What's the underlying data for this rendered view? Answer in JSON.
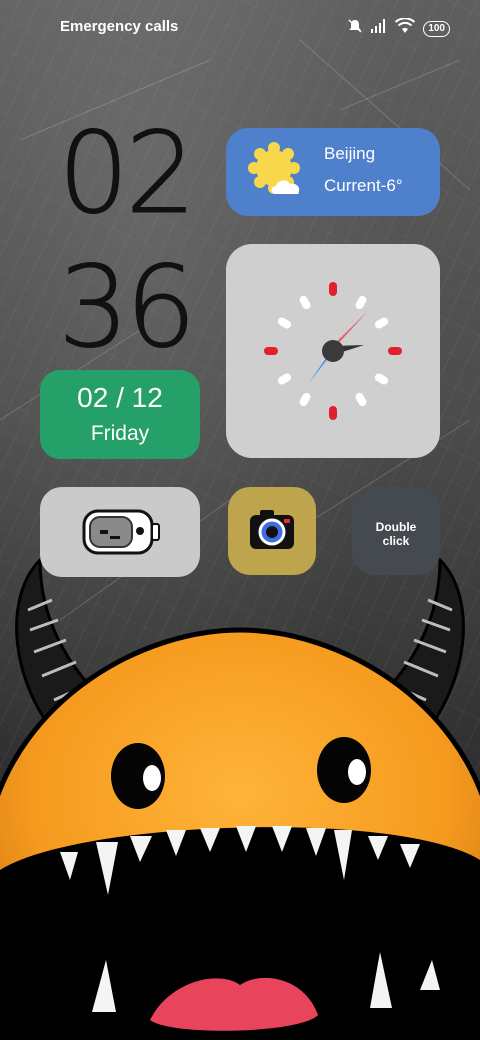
{
  "status_bar": {
    "carrier_text": "Emergency calls",
    "battery_level": "100",
    "icons": [
      "mute-icon",
      "signal-icon",
      "wifi-icon",
      "battery-icon"
    ]
  },
  "clock": {
    "hours": "02",
    "minutes": "36"
  },
  "weather_widget": {
    "city": "Beijing",
    "condition_text": "Current-6°",
    "icon": "partly-cloudy-icon",
    "background": "#4f80cc"
  },
  "date_widget": {
    "date": "02 / 12",
    "weekday": "Friday",
    "background": "#25a068"
  },
  "shortcut_widgets": {
    "battery_face_icon": "battery-robot-icon",
    "camera_icon": "camera-icon",
    "double_click_line1": "Double",
    "double_click_line2": "click"
  },
  "wallpaper": {
    "description_icon": "orange-monster-wallpaper"
  }
}
